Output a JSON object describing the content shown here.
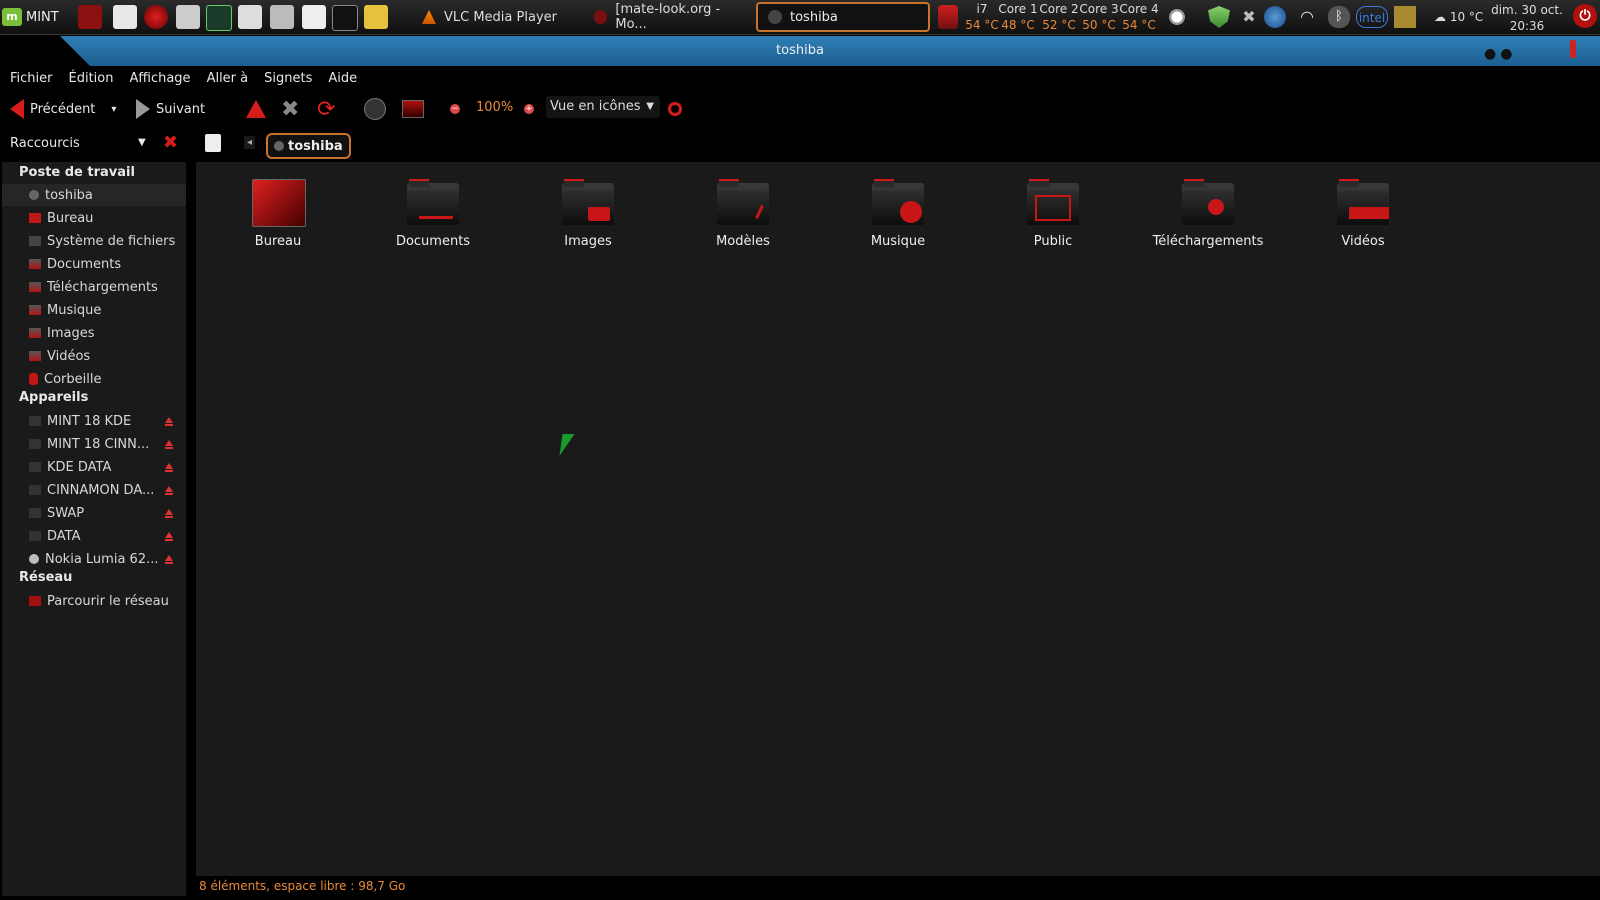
{
  "panel": {
    "menu_label": "MINT",
    "tasks": [
      {
        "label": "VLC Media Player"
      },
      {
        "label": "[mate-look.org - Mo..."
      },
      {
        "label": "toshiba"
      }
    ],
    "cpu": [
      {
        "name": "i7",
        "temp": "54 °C"
      },
      {
        "name": "Core 1",
        "temp": "48 °C"
      },
      {
        "name": "Core 2",
        "temp": "52 °C"
      },
      {
        "name": "Core 3",
        "temp": "50 °C"
      },
      {
        "name": "Core 4",
        "temp": "54 °C"
      }
    ],
    "tray_intel": "intel",
    "weather": "10 °C",
    "clock_date": "dim. 30 oct.",
    "clock_time": "20:36"
  },
  "window": {
    "title": "toshiba"
  },
  "menubar": {
    "items": [
      "Fichier",
      "Édition",
      "Affichage",
      "Aller à",
      "Signets",
      "Aide"
    ]
  },
  "toolbar": {
    "back_label": "Précédent",
    "forward_label": "Suivant",
    "zoom": "100%",
    "view_mode": "Vue en icônes"
  },
  "location": {
    "sidebar_mode": "Raccourcis",
    "current": "toshiba"
  },
  "sidebar": {
    "sections": [
      {
        "title": "Poste de travail"
      },
      {
        "title": "Appareils"
      },
      {
        "title": "Réseau"
      }
    ],
    "places": [
      "toshiba",
      "Bureau",
      "Système de fichiers",
      "Documents",
      "Téléchargements",
      "Musique",
      "Images",
      "Vidéos",
      "Corbeille"
    ],
    "devices": [
      "MINT 18 KDE",
      "MINT 18 CINN...",
      "KDE DATA",
      "CINNAMON DA...",
      "SWAP",
      "DATA",
      "Nokia Lumia 62..."
    ],
    "network": [
      "Parcourir le réseau"
    ]
  },
  "folders": [
    "Bureau",
    "Documents",
    "Images",
    "Modèles",
    "Musique",
    "Public",
    "Téléchargements",
    "Vidéos"
  ],
  "status": "8 éléments, espace libre : 98,7 Go",
  "colors": {
    "accent": "#c8742f",
    "red": "#d81c1c",
    "titlebar": "#2a74ab",
    "status_text": "#e88a3a"
  }
}
